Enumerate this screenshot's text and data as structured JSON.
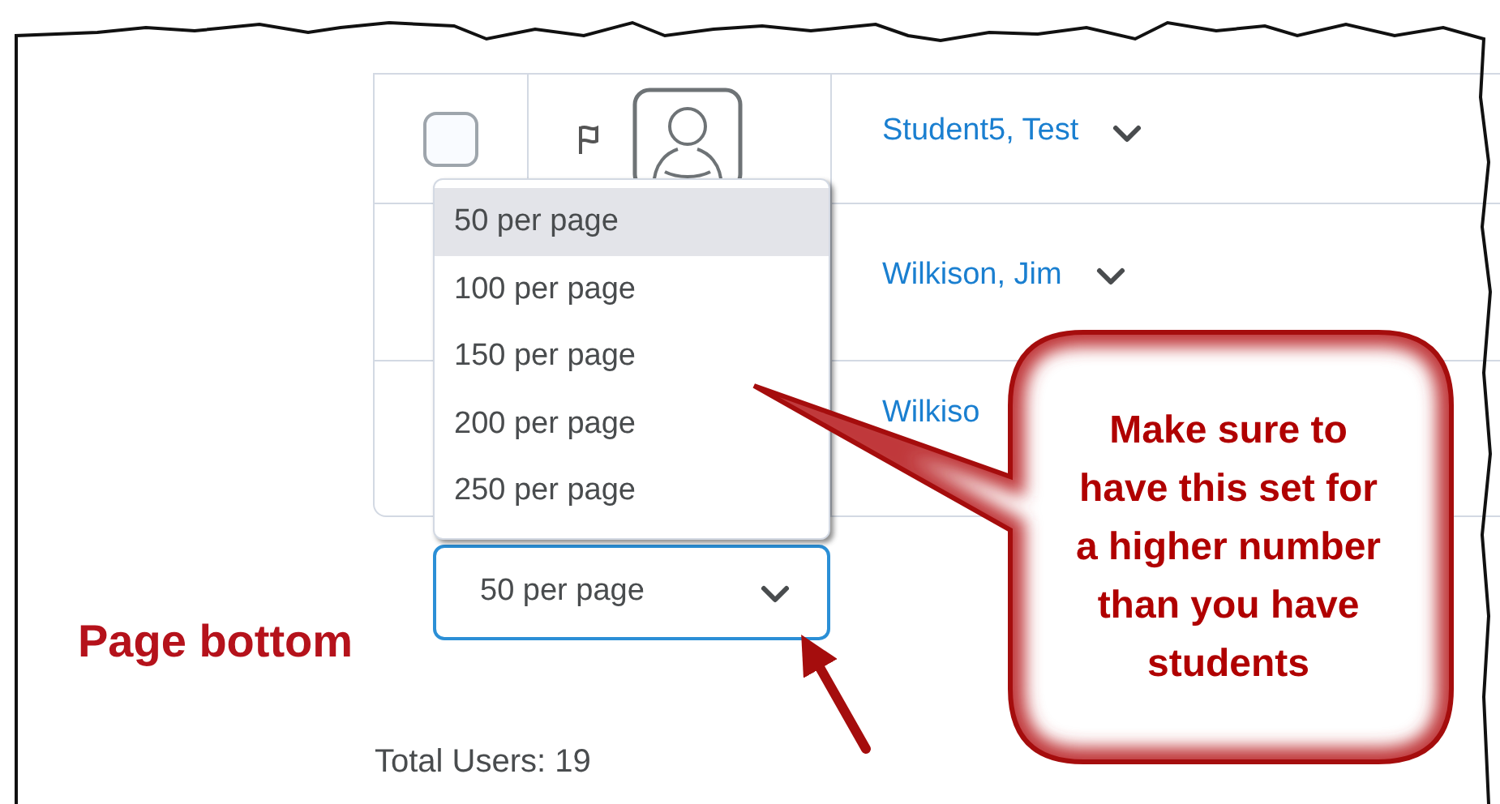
{
  "users": [
    {
      "kind": "full",
      "checked": false,
      "name": "Student5, Test"
    },
    {
      "kind": "covered",
      "name": "Wilkison, Jim"
    },
    {
      "kind": "cut",
      "name": "Wilkiso"
    }
  ],
  "page_size": {
    "value": "50 per page",
    "expanded": true,
    "options": [
      {
        "label": "50 per page",
        "selected": true
      },
      {
        "label": "100 per page",
        "selected": false
      },
      {
        "label": "150 per page",
        "selected": false
      },
      {
        "label": "200 per page",
        "selected": false
      },
      {
        "label": "250 per page",
        "selected": false
      }
    ]
  },
  "total_users": "Total Users: 19",
  "annotations": {
    "label": "Page bottom",
    "callout": "Make sure to have this set for a higher number than you have students"
  }
}
